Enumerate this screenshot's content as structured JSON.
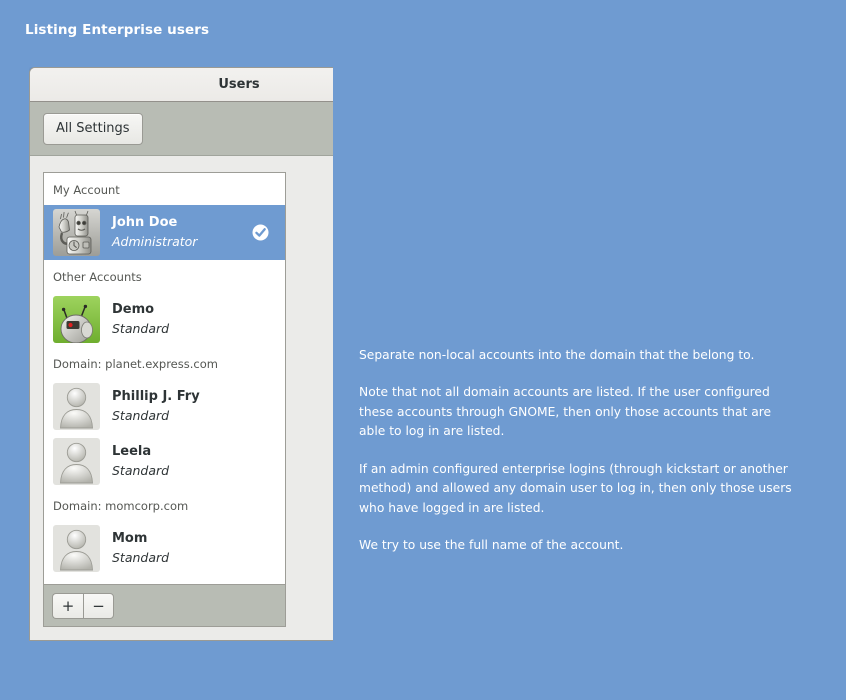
{
  "slide": {
    "title": "Listing Enterprise users"
  },
  "window": {
    "title": "Users",
    "toolbar": {
      "all_settings_label": "All Settings"
    },
    "list_actions": {
      "add_label": "+",
      "remove_label": "−"
    }
  },
  "user_list": {
    "sections": [
      {
        "header": "My Account",
        "users": [
          {
            "name": "John Doe",
            "type": "Administrator",
            "avatar": "robot-grayscale-avatar",
            "selected": true,
            "badge": "check-circle-icon"
          }
        ]
      },
      {
        "header": "Other Accounts",
        "users": [
          {
            "name": "Demo",
            "type": "Standard",
            "avatar": "robot-green-avatar",
            "selected": false,
            "badge": null
          }
        ]
      },
      {
        "header": "Domain: planet.express.com",
        "users": [
          {
            "name": "Phillip J. Fry",
            "type": "Standard",
            "avatar": "generic-person-avatar",
            "selected": false,
            "badge": null
          },
          {
            "name": "Leela",
            "type": "Standard",
            "avatar": "generic-person-avatar",
            "selected": false,
            "badge": null
          }
        ]
      },
      {
        "header": "Domain: momcorp.com",
        "users": [
          {
            "name": "Mom",
            "type": "Standard",
            "avatar": "generic-person-avatar",
            "selected": false,
            "badge": null
          }
        ]
      }
    ]
  },
  "notes": {
    "paragraphs": [
      "Separate non-local accounts into the domain that the belong to.",
      "Note that not all domain accounts are listed. If the user configured these accounts through GNOME, then only those accounts that are able to log in are listed.",
      "If an admin configured enterprise logins (through kickstart or another method) and allowed any domain user to log in, then only those users who have logged in are listed.",
      "We try to use the full name of the account."
    ]
  },
  "colors": {
    "background_blue": "#6f9bd1",
    "selection_blue": "#6f9bd1",
    "toolbar_gray": "#b8bcb4",
    "window_bg": "#ebebe9",
    "text_dark": "#2e3436",
    "demo_avatar_green": "#8ac24a"
  }
}
